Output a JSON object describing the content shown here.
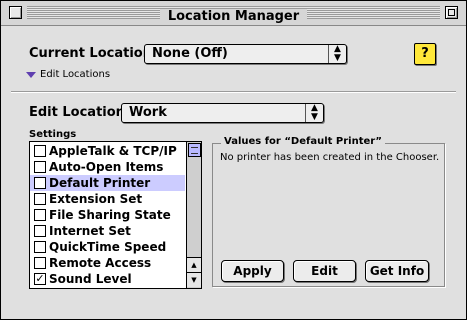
{
  "window": {
    "title": "Location Manager"
  },
  "current_location": {
    "label": "Current Location:",
    "value": "None (Off)"
  },
  "help_button": {
    "label": "?"
  },
  "edit_locations": {
    "label": "Edit Locations"
  },
  "edit_location": {
    "label": "Edit Location:",
    "value": "Work"
  },
  "settings": {
    "label": "Settings",
    "items": [
      {
        "label": "AppleTalk & TCP/IP",
        "checked": false,
        "selected": false
      },
      {
        "label": "Auto-Open Items",
        "checked": false,
        "selected": false
      },
      {
        "label": "Default Printer",
        "checked": false,
        "selected": true
      },
      {
        "label": "Extension Set",
        "checked": false,
        "selected": false
      },
      {
        "label": "File Sharing State",
        "checked": false,
        "selected": false
      },
      {
        "label": "Internet Set",
        "checked": false,
        "selected": false
      },
      {
        "label": "QuickTime Speed",
        "checked": false,
        "selected": false
      },
      {
        "label": "Remote Access",
        "checked": false,
        "selected": false
      },
      {
        "label": "Sound Level",
        "checked": true,
        "selected": false
      }
    ]
  },
  "values_group": {
    "title": "Values for “Default Printer”",
    "message": "No printer has been created in the Chooser."
  },
  "buttons": {
    "apply": "Apply",
    "edit": "Edit",
    "get_info": "Get Info"
  }
}
